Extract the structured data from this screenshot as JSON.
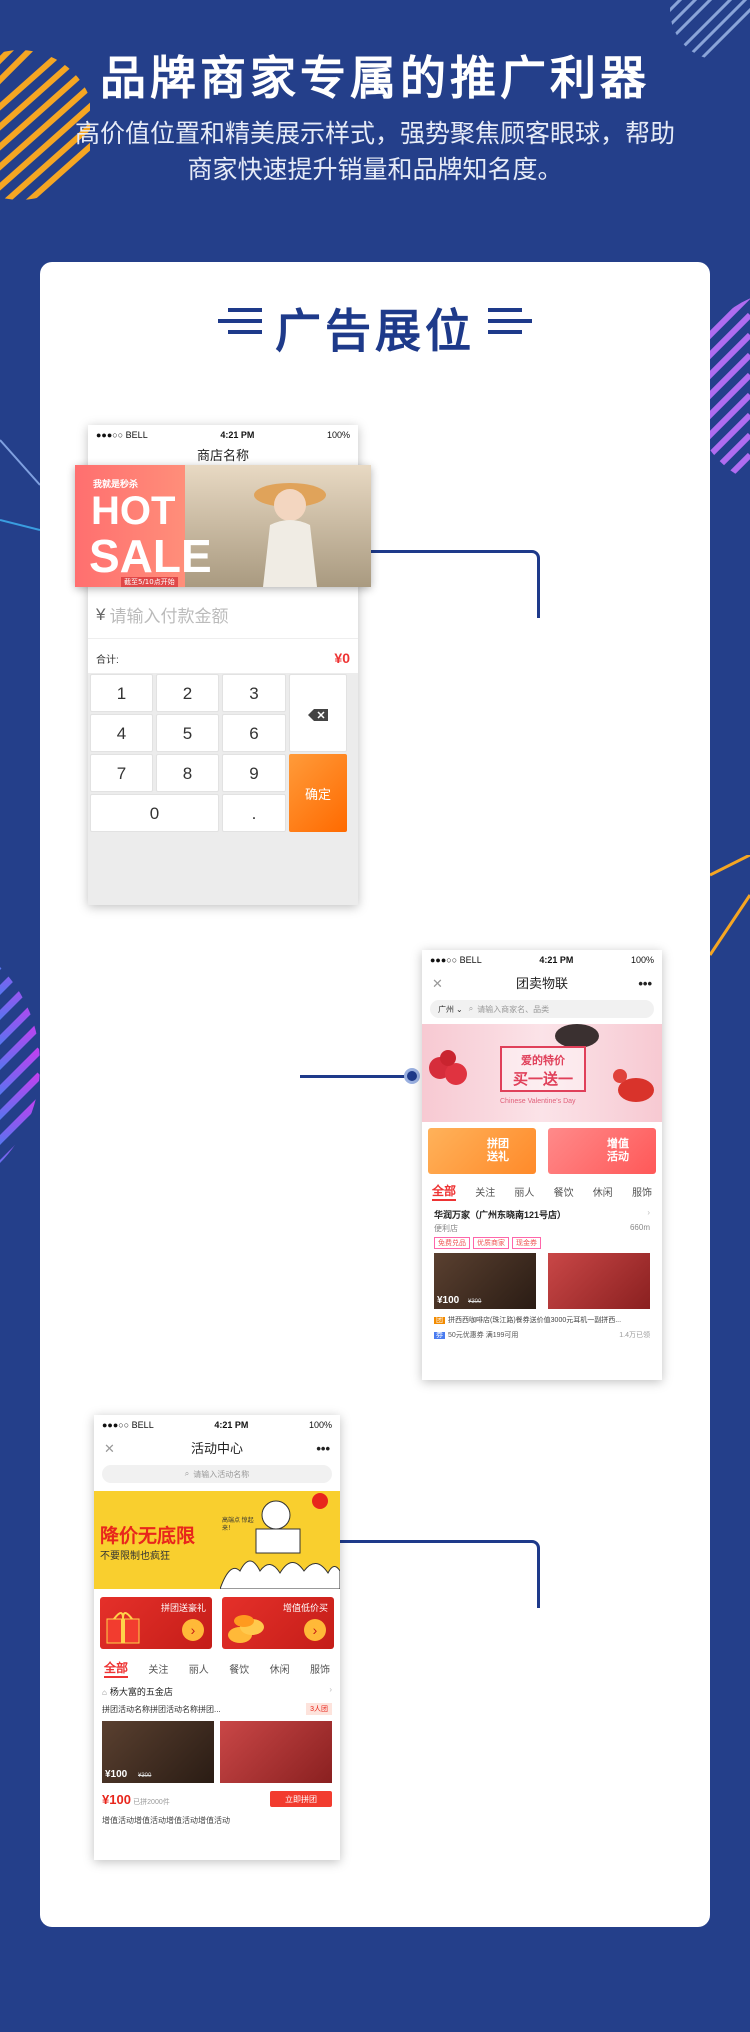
{
  "header": {
    "title": "品牌商家专属的推广利器",
    "subtitle": "高价值位置和精美展示样式，强势聚焦顾客眼球，帮助商家快速提升销量和品牌知名度。"
  },
  "section": {
    "title": "广告展位"
  },
  "phone1": {
    "status": {
      "carrier": "●●●○○ BELL",
      "time": "4:21 PM",
      "battery": "100%"
    },
    "shop_name": "商店名称",
    "banner": {
      "tagline": "我就是秒杀",
      "line1": "HOT",
      "line2": "SALE",
      "footnote": "截至5/10点开始"
    },
    "amount_placeholder": "请输入付款金额",
    "currency": "¥",
    "total_label": "合计:",
    "total_value": "¥0",
    "keys": [
      "1",
      "2",
      "3",
      "4",
      "5",
      "6",
      "7",
      "8",
      "9",
      "0",
      "."
    ],
    "confirm": "确定"
  },
  "phone2": {
    "status": {
      "carrier": "●●●○○ BELL",
      "time": "4:21 PM",
      "battery": "100%"
    },
    "title": "团卖物联",
    "city": "广州",
    "search_placeholder": "请输入商家名、品类",
    "banner": {
      "line1": "爱的特价",
      "line2": "买一送一",
      "caption": "Chinese Valentine's Day"
    },
    "promo1": "拼团送礼",
    "promo2": "增值活动",
    "tabs": [
      "全部",
      "关注",
      "丽人",
      "餐饮",
      "休闲",
      "服饰"
    ],
    "store": {
      "name": "华润万家（广州东晓南121号店）",
      "type": "便利店",
      "distance": "660m",
      "tags": [
        "免费兑品",
        "优质商家",
        "现金券"
      ],
      "price": "¥100",
      "orig": "¥300",
      "deal_text": "拼西西咖啡店(珠江路)餐券送价值3000元耳机一副拼西...",
      "coupon": "50元优惠券 满199可用",
      "sold": "1.4万已领"
    }
  },
  "phone3": {
    "status": {
      "carrier": "●●●○○ BELL",
      "time": "4:21 PM",
      "battery": "100%"
    },
    "title": "活动中心",
    "search_placeholder": "请输入活动名称",
    "banner": {
      "line1": "降价无底限",
      "line2": "不要限制也疯狂",
      "badge": "高端点 惊起来！"
    },
    "promo1": "拼团送豪礼",
    "promo2": "增值低价买",
    "tabs": [
      "全部",
      "关注",
      "丽人",
      "餐饮",
      "休闲",
      "服饰"
    ],
    "store": {
      "name": "杨大富的五金店",
      "deal": "拼团活动名称拼团活动名称拼团...",
      "badge": "3人团",
      "price": "¥100",
      "orig": "¥300",
      "sold": "已拼2000件",
      "button": "立即拼团",
      "more": "增值活动增值活动增值活动增值活动"
    }
  },
  "colors": {
    "background": "#243f8a",
    "accent": "#1e3a8a",
    "orange": "#ff7a00",
    "red": "#e33333"
  }
}
